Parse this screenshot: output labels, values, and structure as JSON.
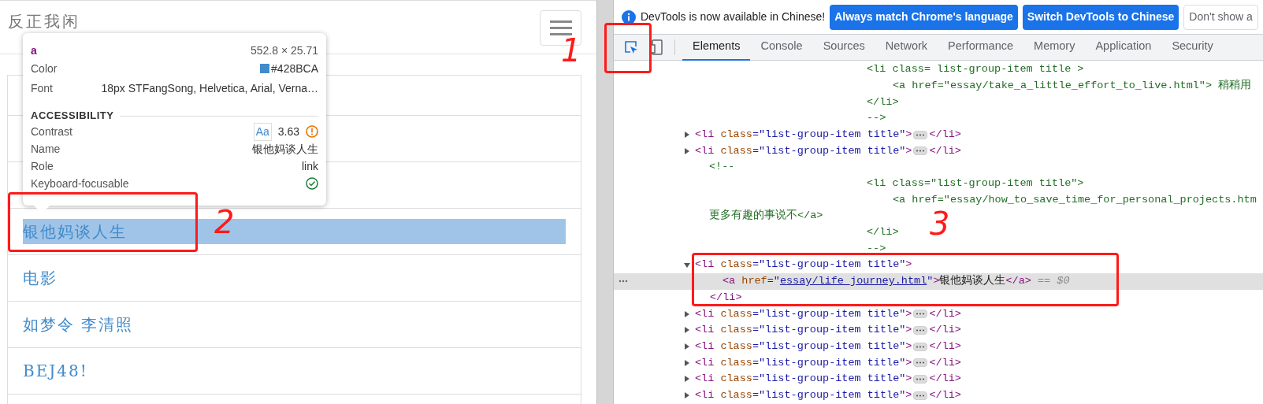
{
  "page": {
    "site_title": "反正我闲",
    "list": [
      {
        "kind": "blank"
      },
      {
        "kind": "blank"
      },
      {
        "kind": "blank"
      },
      {
        "kind": "link",
        "text": "银他妈谈人生",
        "highlighted": true
      },
      {
        "kind": "link",
        "text": "电影",
        "highlighted": false
      },
      {
        "kind": "link",
        "text": "如梦令 李清照",
        "highlighted": false
      },
      {
        "kind": "link",
        "text": "BEJ48!",
        "highlighted": false
      },
      {
        "kind": "blank"
      }
    ]
  },
  "tooltip": {
    "tag": "a",
    "size": "552.8 × 25.71",
    "rows": [
      {
        "kind": "color",
        "label": "Color",
        "value": "#428BCA",
        "color": "#428bca"
      },
      {
        "kind": "font",
        "label": "Font",
        "value": "18px STFangSong, Helvetica, Arial, Verna…"
      }
    ],
    "section": "ACCESSIBILITY",
    "a11y": [
      {
        "kind": "contrast",
        "label": "Contrast",
        "sample": "Aa",
        "value": "3.63"
      },
      {
        "kind": "text",
        "label": "Name",
        "value": "银他妈谈人生"
      },
      {
        "kind": "text",
        "label": "Role",
        "value": "link"
      },
      {
        "kind": "check",
        "label": "Keyboard-focusable"
      }
    ]
  },
  "devtools": {
    "info": "DevTools is now available in Chinese!",
    "buttons": [
      {
        "label": "Always match Chrome's language",
        "kind": "primary"
      },
      {
        "label": "Switch DevTools to Chinese",
        "kind": "primary"
      },
      {
        "label": "Don't show a",
        "kind": "plain"
      }
    ],
    "tabs": [
      {
        "label": "Elements",
        "selected": true
      },
      {
        "label": "Console",
        "selected": false
      },
      {
        "label": "Sources",
        "selected": false
      },
      {
        "label": "Network",
        "selected": false
      },
      {
        "label": "Performance",
        "selected": false
      },
      {
        "label": "Memory",
        "selected": false
      },
      {
        "label": "Application",
        "selected": false
      },
      {
        "label": "Security",
        "selected": false
      }
    ],
    "lines": [
      {
        "kind": "comment_tag",
        "parts": [
          {
            "kind": "comment",
            "text": "<li class= list-group-item title >"
          }
        ]
      },
      {
        "kind": "comment_inner",
        "parts": [
          {
            "kind": "comment",
            "text": "<a href=\"essay/take_a_little_effort_to_live.html\"> 稍稍用"
          }
        ]
      },
      {
        "kind": "comment_tag",
        "parts": [
          {
            "kind": "comment",
            "text": "</li>"
          }
        ]
      },
      {
        "kind": "comment_tag",
        "parts": [
          {
            "kind": "comment",
            "text": "-->"
          }
        ]
      },
      {
        "kind": "collapsed",
        "parts": [
          {
            "kind": "tag",
            "text": "<li"
          },
          {
            "kind": "attr",
            "text": " class"
          },
          {
            "kind": "value",
            "text": "=\"list-group-item title\""
          },
          {
            "kind": "tag",
            "text": ">"
          },
          {
            "kind": "ellipsis"
          },
          {
            "kind": "tag",
            "text": "</li>"
          }
        ]
      },
      {
        "kind": "collapsed",
        "parts": [
          {
            "kind": "tag",
            "text": "<li"
          },
          {
            "kind": "attr",
            "text": " class"
          },
          {
            "kind": "value",
            "text": "=\"list-group-item title\""
          },
          {
            "kind": "tag",
            "text": ">"
          },
          {
            "kind": "ellipsis"
          },
          {
            "kind": "tag",
            "text": "</li>"
          }
        ]
      },
      {
        "kind": "comment_outer",
        "parts": [
          {
            "kind": "comment",
            "text": "<!--"
          }
        ]
      },
      {
        "kind": "comment_tag",
        "parts": [
          {
            "kind": "comment",
            "text": "<li class=\"list-group-item title\">"
          }
        ]
      },
      {
        "kind": "comment_inner",
        "parts": [
          {
            "kind": "comment",
            "text": "<a href=\"essay/how_to_save_time_for_personal_projects.htm"
          }
        ]
      },
      {
        "kind": "comment_outer",
        "parts": [
          {
            "kind": "comment",
            "text": "更多有趣的事说不</a>"
          }
        ]
      },
      {
        "kind": "comment_tag",
        "parts": [
          {
            "kind": "comment",
            "text": "</li>"
          }
        ]
      },
      {
        "kind": "comment_tag",
        "parts": [
          {
            "kind": "comment",
            "text": "-->"
          }
        ]
      },
      {
        "kind": "open",
        "parts": [
          {
            "kind": "tag",
            "text": "<li"
          },
          {
            "kind": "attr",
            "text": " class"
          },
          {
            "kind": "value",
            "text": "=\"list-group-item title\""
          },
          {
            "kind": "tag",
            "text": ">"
          }
        ]
      },
      {
        "kind": "child",
        "selected": true,
        "parts": [
          {
            "kind": "tag",
            "text": "<a"
          },
          {
            "kind": "attr",
            "text": " href"
          },
          {
            "kind": "value",
            "text": "=\""
          },
          {
            "kind": "link",
            "text": "essay/life_journey.html"
          },
          {
            "kind": "value",
            "text": "\""
          },
          {
            "kind": "tag",
            "text": ">"
          },
          {
            "kind": "text",
            "text": "银他妈谈人生"
          },
          {
            "kind": "tag",
            "text": "</a>"
          },
          {
            "kind": "ref",
            "text": " == $0"
          }
        ]
      },
      {
        "kind": "close",
        "parts": [
          {
            "kind": "tag",
            "text": "</li>"
          }
        ]
      },
      {
        "kind": "collapsed",
        "parts": [
          {
            "kind": "tag",
            "text": "<li"
          },
          {
            "kind": "attr",
            "text": " class"
          },
          {
            "kind": "value",
            "text": "=\"list-group-item title\""
          },
          {
            "kind": "tag",
            "text": ">"
          },
          {
            "kind": "ellipsis"
          },
          {
            "kind": "tag",
            "text": "</li>"
          }
        ]
      },
      {
        "kind": "collapsed",
        "parts": [
          {
            "kind": "tag",
            "text": "<li"
          },
          {
            "kind": "attr",
            "text": " class"
          },
          {
            "kind": "value",
            "text": "=\"list-group-item title\""
          },
          {
            "kind": "tag",
            "text": ">"
          },
          {
            "kind": "ellipsis"
          },
          {
            "kind": "tag",
            "text": "</li>"
          }
        ]
      },
      {
        "kind": "collapsed",
        "parts": [
          {
            "kind": "tag",
            "text": "<li"
          },
          {
            "kind": "attr",
            "text": " class"
          },
          {
            "kind": "value",
            "text": "=\"list-group-item title\""
          },
          {
            "kind": "tag",
            "text": ">"
          },
          {
            "kind": "ellipsis"
          },
          {
            "kind": "tag",
            "text": "</li>"
          }
        ]
      },
      {
        "kind": "collapsed",
        "parts": [
          {
            "kind": "tag",
            "text": "<li"
          },
          {
            "kind": "attr",
            "text": " class"
          },
          {
            "kind": "value",
            "text": "=\"list-group-item title\""
          },
          {
            "kind": "tag",
            "text": ">"
          },
          {
            "kind": "ellipsis"
          },
          {
            "kind": "tag",
            "text": "</li>"
          }
        ]
      },
      {
        "kind": "collapsed",
        "parts": [
          {
            "kind": "tag",
            "text": "<li"
          },
          {
            "kind": "attr",
            "text": " class"
          },
          {
            "kind": "value",
            "text": "=\"list-group-item title\""
          },
          {
            "kind": "tag",
            "text": ">"
          },
          {
            "kind": "ellipsis"
          },
          {
            "kind": "tag",
            "text": "</li>"
          }
        ]
      },
      {
        "kind": "collapsed",
        "parts": [
          {
            "kind": "tag",
            "text": "<li"
          },
          {
            "kind": "attr",
            "text": " class"
          },
          {
            "kind": "value",
            "text": "=\"list-group-item title\""
          },
          {
            "kind": "tag",
            "text": ">"
          },
          {
            "kind": "ellipsis"
          },
          {
            "kind": "tag",
            "text": "</li>"
          }
        ]
      }
    ]
  },
  "annotations": [
    {
      "kind": "number",
      "label": "1"
    },
    {
      "kind": "number",
      "label": "2"
    },
    {
      "kind": "number",
      "label": "3"
    },
    {
      "kind": "box"
    },
    {
      "kind": "box"
    },
    {
      "kind": "box"
    }
  ]
}
